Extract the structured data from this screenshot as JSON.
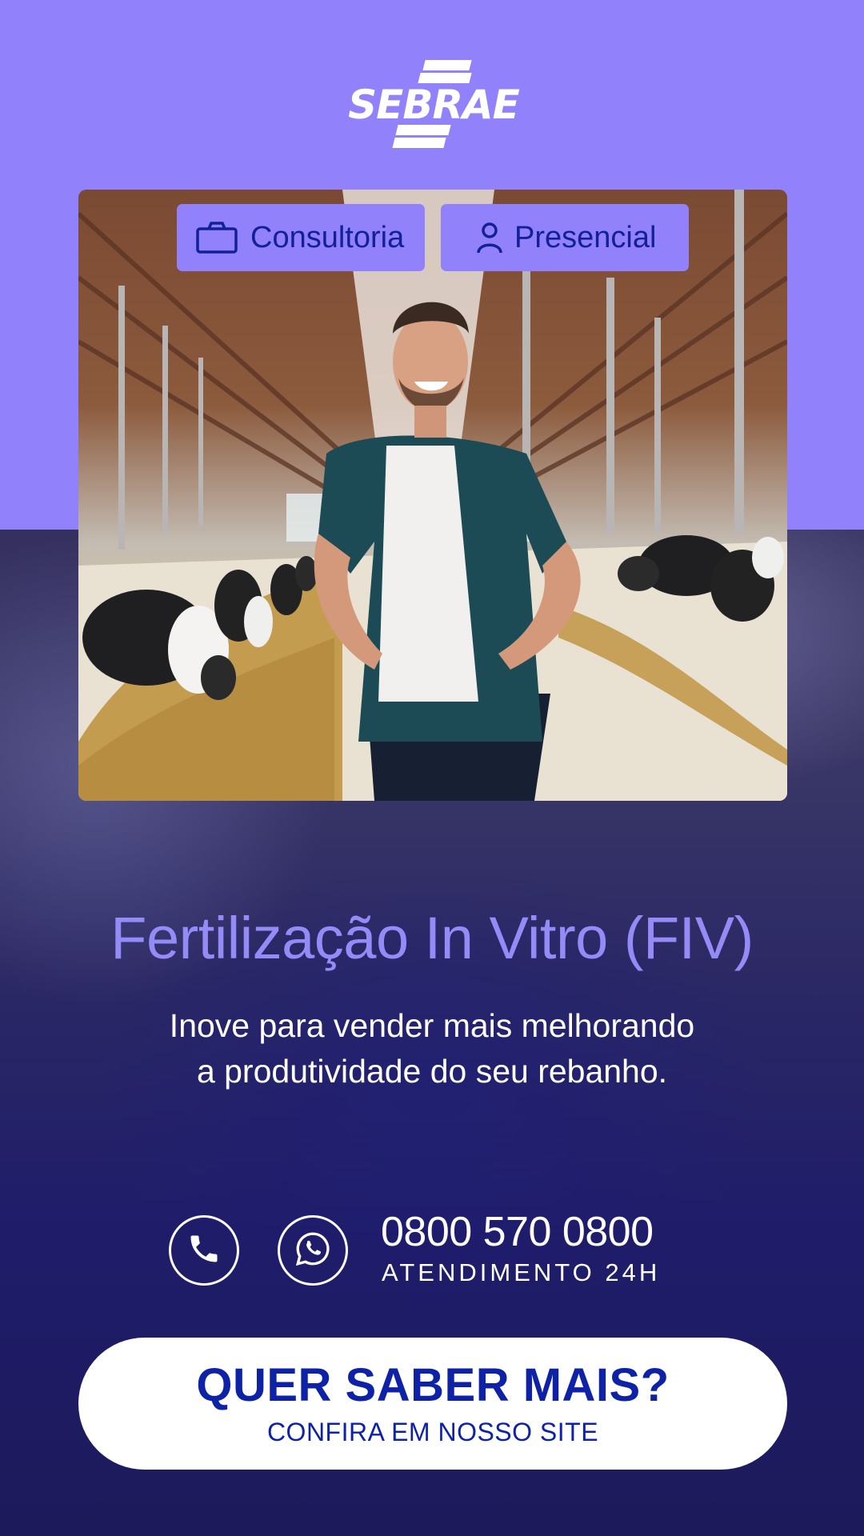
{
  "brand": {
    "name": "SEBRAE"
  },
  "tags": [
    {
      "label": "Consultoria",
      "icon": "briefcase-icon"
    },
    {
      "label": "Presencial",
      "icon": "person-icon"
    }
  ],
  "hero": {
    "title": "Fertilização In Vitro (FIV)",
    "subtitle_line1": "Inove para vender mais melhorando",
    "subtitle_line2": "a produtividade do seu rebanho."
  },
  "contact": {
    "phone": "0800 570 0800",
    "caption": "ATENDIMENTO 24H",
    "icons": [
      "phone-icon",
      "whatsapp-icon"
    ]
  },
  "cta": {
    "title": "QUER SABER MAIS?",
    "subtitle": "CONFIRA EM NOSSO SITE"
  },
  "colors": {
    "lavender": "#9181fb",
    "navy": "#1e1a5e",
    "brand_blue": "#0d22a6",
    "headline": "#958bf7"
  }
}
